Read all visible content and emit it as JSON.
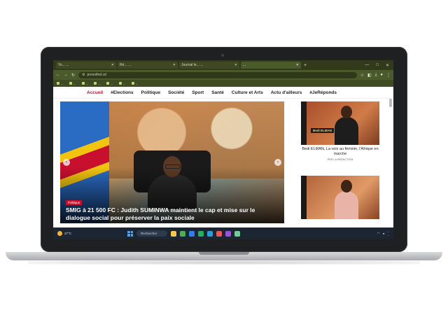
{
  "browser": {
    "tabs": [
      {
        "label": "Yo... ...",
        "active": false
      },
      {
        "label": "Ré... ...",
        "active": false
      },
      {
        "label": "Journal le... ...",
        "active": false
      },
      {
        "label": "...",
        "active": true
      }
    ],
    "new_tab": "+",
    "window_controls": [
      "—",
      "□",
      "✕"
    ],
    "address": "prevoifed.cd",
    "bookmarks": [
      "...",
      "...",
      "...",
      "...",
      "...",
      "...",
      "..."
    ]
  },
  "site": {
    "nav": [
      "Accueil",
      "#Elections",
      "Politique",
      "Société",
      "Sport",
      "Santé",
      "Culture et Arts",
      "Actu d'ailleurs",
      "#JeRéponds"
    ],
    "hero": {
      "category": "Politique",
      "title": "SMIG à 21 500 FC : Judith SUMINWA maintient le cap et mise sur le dialogue social pour préserver la paix sociale",
      "prev": "‹",
      "next": "›"
    },
    "side_cards": [
      {
        "name_tag": "Bedi ELMAN",
        "title": "Bedi ELMAN, La voix au féminin, l'Afrique en marche",
        "meta": "PAR LA RÉDACTION"
      },
      {
        "name_tag": "",
        "title": "",
        "meta": ""
      }
    ]
  },
  "taskbar": {
    "weather_temp": "27°C",
    "search_placeholder": "Rechercher",
    "time": "...",
    "date": "..."
  },
  "colors": {
    "accent": "#c8102e",
    "chrome": "#4b5a2a",
    "taskbar": "#1c2633"
  }
}
